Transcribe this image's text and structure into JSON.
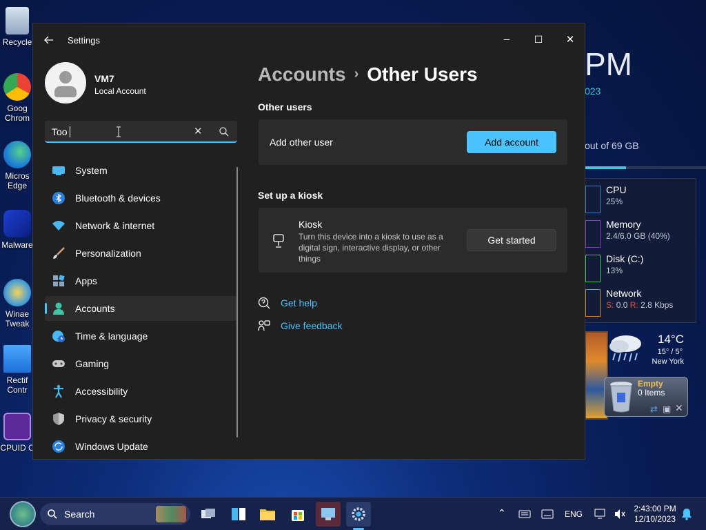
{
  "desktop": {
    "icons": [
      {
        "label": "Recycle"
      },
      {
        "label": "Goog\nChrom"
      },
      {
        "label": "Micros\nEdge"
      },
      {
        "label": "Malware"
      },
      {
        "label": "Winae\nTweak"
      },
      {
        "label": "Rectif\nContr"
      },
      {
        "label": "CPUID C"
      }
    ]
  },
  "widgets": {
    "clock_big": "PM",
    "clock_date": "023",
    "disk_text": "out of 69 GB",
    "perf": [
      {
        "name": "CPU",
        "value": "25%"
      },
      {
        "name": "Memory",
        "value": "2.4/6.0 GB (40%)"
      },
      {
        "name": "Disk (C:)",
        "value": "13%"
      },
      {
        "name": "Network",
        "send_label": "S:",
        "send": "0.0",
        "recv_label": "R:",
        "recv": "2.8 Kbps"
      }
    ],
    "weather": {
      "temp": "14°C",
      "range": "15° / 5°",
      "city": "New York"
    },
    "recycle": {
      "title": "Empty",
      "count": "0 Items"
    }
  },
  "window": {
    "title": "Settings",
    "controls": {
      "minimize": "─",
      "maximize": "☐",
      "close": "✕"
    }
  },
  "user": {
    "name": "VM7",
    "type": "Local Account"
  },
  "search": {
    "value": "Too",
    "clear": "✕"
  },
  "nav": [
    {
      "label": "System",
      "icon": "monitor-icon",
      "selected": false
    },
    {
      "label": "Bluetooth & devices",
      "icon": "bluetooth-icon",
      "selected": false
    },
    {
      "label": "Network & internet",
      "icon": "wifi-icon",
      "selected": false
    },
    {
      "label": "Personalization",
      "icon": "brush-icon",
      "selected": false
    },
    {
      "label": "Apps",
      "icon": "apps-icon",
      "selected": false
    },
    {
      "label": "Accounts",
      "icon": "person-icon",
      "selected": true
    },
    {
      "label": "Time & language",
      "icon": "globe-clock-icon",
      "selected": false
    },
    {
      "label": "Gaming",
      "icon": "gamepad-icon",
      "selected": false
    },
    {
      "label": "Accessibility",
      "icon": "accessibility-icon",
      "selected": false
    },
    {
      "label": "Privacy & security",
      "icon": "shield-icon",
      "selected": false
    },
    {
      "label": "Windows Update",
      "icon": "update-icon",
      "selected": false
    }
  ],
  "content": {
    "breadcrumb": {
      "parent": "Accounts",
      "separator": "›",
      "current": "Other Users"
    },
    "other_users": {
      "title": "Other users",
      "add_label": "Add other user",
      "add_button": "Add account"
    },
    "kiosk": {
      "section_title": "Set up a kiosk",
      "title": "Kiosk",
      "description": "Turn this device into a kiosk to use as a digital sign, interactive display, or other things",
      "button": "Get started"
    },
    "links": {
      "help": "Get help",
      "feedback": "Give feedback"
    }
  },
  "taskbar": {
    "search_label": "Search",
    "lang": "ENG",
    "time": "2:43:00 PM",
    "date": "12/10/2023"
  },
  "colors": {
    "accent": "#4cc2ff",
    "window_bg": "#202020",
    "card_bg": "#2b2b2b"
  }
}
